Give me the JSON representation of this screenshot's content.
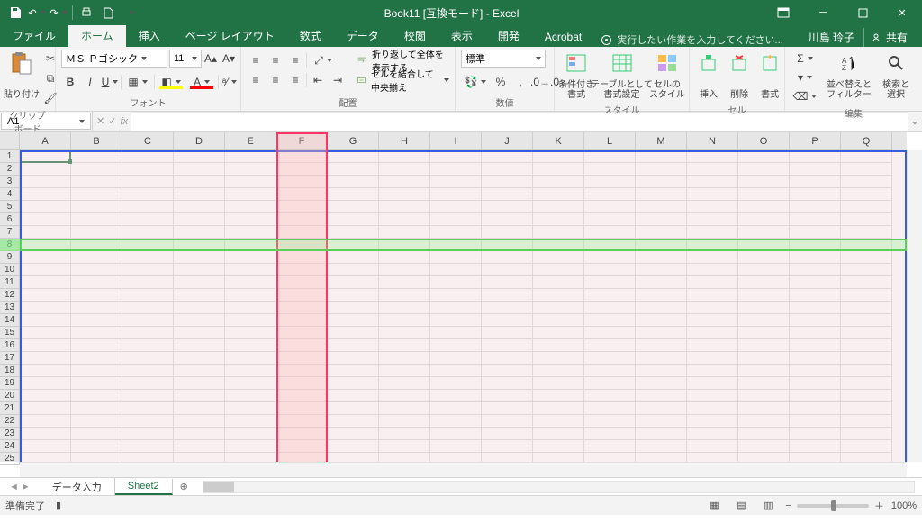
{
  "title": "Book11  [互換モード] - Excel",
  "user_name": "川島 玲子",
  "share_label": "共有",
  "tabs": {
    "file": "ファイル",
    "home": "ホーム",
    "insert": "挿入",
    "pagelayout": "ページ レイアウト",
    "formulas": "数式",
    "data": "データ",
    "review": "校閲",
    "view": "表示",
    "developer": "開発",
    "acrobat": "Acrobat"
  },
  "tellme_placeholder": "実行したい作業を入力してください...",
  "ribbon": {
    "clipboard": {
      "paste": "貼り付け",
      "label": "クリップボード"
    },
    "font": {
      "name": "ＭＳ Ｐゴシック",
      "size": "11",
      "label": "フォント"
    },
    "alignment": {
      "wrap": "折り返して全体を表示する",
      "merge": "セルを結合して中央揃え",
      "label": "配置"
    },
    "number": {
      "format": "標準",
      "label": "数値"
    },
    "styles": {
      "cond": "条件付き\n書式",
      "table": "テーブルとして\n書式設定",
      "cell": "セルの\nスタイル",
      "label": "スタイル"
    },
    "cells": {
      "insert": "挿入",
      "delete": "削除",
      "format": "書式",
      "label": "セル"
    },
    "editing": {
      "sort": "並べ替えと\nフィルター",
      "find": "検索と\n選択",
      "label": "編集"
    }
  },
  "namebox": "A1",
  "columns": [
    "A",
    "B",
    "C",
    "D",
    "E",
    "F",
    "G",
    "H",
    "I",
    "J",
    "K",
    "L",
    "M",
    "N",
    "O",
    "P",
    "Q"
  ],
  "rows": [
    1,
    2,
    3,
    4,
    5,
    6,
    7,
    8,
    9,
    10,
    11,
    12,
    13,
    14,
    15,
    16,
    17,
    18,
    19,
    20,
    21,
    22,
    23,
    24,
    25
  ],
  "sheets": {
    "sheet1": "データ入力",
    "sheet2": "Sheet2"
  },
  "status": "準備完了",
  "zoom": "100%"
}
